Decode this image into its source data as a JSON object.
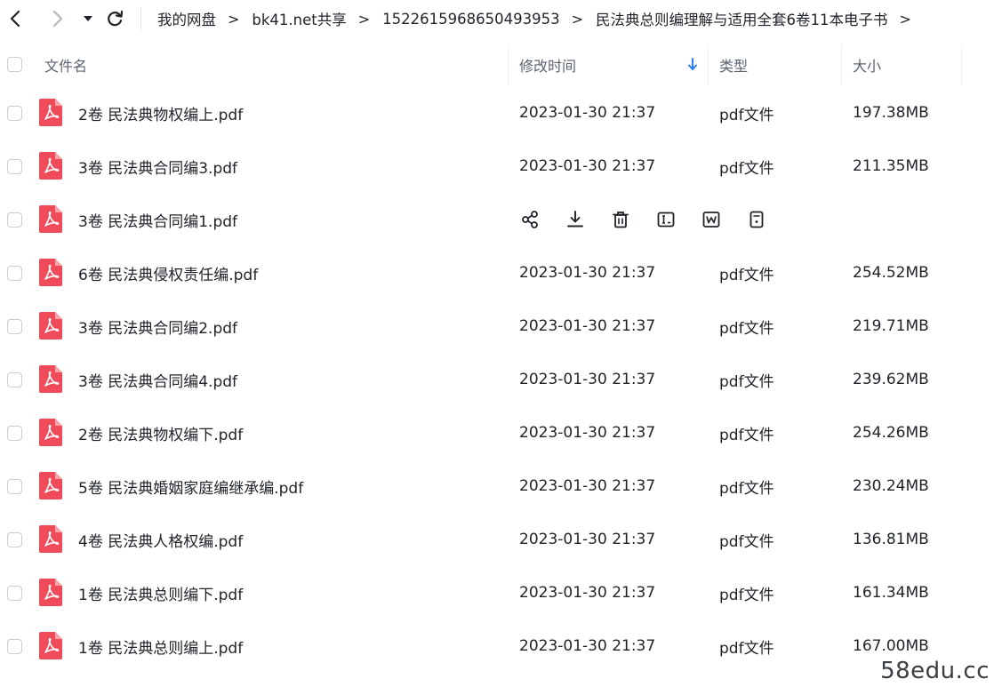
{
  "breadcrumb": [
    {
      "label": "我的网盘"
    },
    {
      "label": "bk41.net共享"
    },
    {
      "label": "1522615968650493953"
    },
    {
      "label": "民法典总则编理解与适用全套6卷11本电子书"
    }
  ],
  "breadcrumb_sep": ">",
  "columns": {
    "name": "文件名",
    "modified": "修改时间",
    "type": "类型",
    "size": "大小"
  },
  "files": [
    {
      "name": "2卷 民法典物权编上.pdf",
      "modified": "2023-01-30 21:37",
      "type": "pdf文件",
      "size": "197.38MB"
    },
    {
      "name": "3卷 民法典合同编3.pdf",
      "modified": "2023-01-30 21:37",
      "type": "pdf文件",
      "size": "211.35MB"
    },
    {
      "name": "3卷 民法典合同编1.pdf",
      "modified": "",
      "type": "",
      "size": "",
      "hovered": true
    },
    {
      "name": "6卷 民法典侵权责任编.pdf",
      "modified": "2023-01-30 21:37",
      "type": "pdf文件",
      "size": "254.52MB"
    },
    {
      "name": "3卷 民法典合同编2.pdf",
      "modified": "2023-01-30 21:37",
      "type": "pdf文件",
      "size": "219.71MB"
    },
    {
      "name": "3卷 民法典合同编4.pdf",
      "modified": "2023-01-30 21:37",
      "type": "pdf文件",
      "size": "239.62MB"
    },
    {
      "name": "2卷 民法典物权编下.pdf",
      "modified": "2023-01-30 21:37",
      "type": "pdf文件",
      "size": "254.26MB"
    },
    {
      "name": "5卷 民法典婚姻家庭编继承编.pdf",
      "modified": "2023-01-30 21:37",
      "type": "pdf文件",
      "size": "230.24MB"
    },
    {
      "name": "4卷 民法典人格权编.pdf",
      "modified": "2023-01-30 21:37",
      "type": "pdf文件",
      "size": "136.81MB"
    },
    {
      "name": "1卷 民法典总则编下.pdf",
      "modified": "2023-01-30 21:37",
      "type": "pdf文件",
      "size": "161.34MB"
    },
    {
      "name": "1卷 民法典总则编上.pdf",
      "modified": "2023-01-30 21:37",
      "type": "pdf文件",
      "size": "167.00MB"
    }
  ],
  "hover_actions": [
    "share-icon",
    "download-icon",
    "delete-icon",
    "rename-icon",
    "word-convert-icon",
    "more-icon"
  ],
  "colors": {
    "pdf": "#f04b5a",
    "sort_arrow": "#2e7cf6",
    "text": "#1f2329",
    "muted": "#5c6370"
  },
  "watermark": "58edu.cc"
}
